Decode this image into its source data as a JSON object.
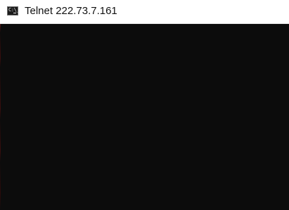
{
  "window": {
    "title": "Telnet 222.73.7.161",
    "icon": "console-icon",
    "icon_text": "C:\\_"
  },
  "console": {
    "background_color": "#0c0c0c"
  }
}
